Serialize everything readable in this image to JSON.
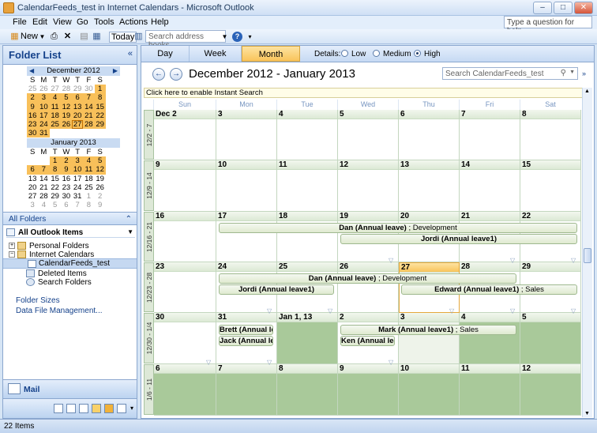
{
  "window": {
    "title": "CalendarFeeds_test in Internet Calendars - Microsoft Outlook",
    "buttons": [
      "–",
      "□",
      "✕"
    ]
  },
  "menu": {
    "items": [
      "File",
      "Edit",
      "View",
      "Go",
      "Tools",
      "Actions",
      "Help"
    ],
    "help_placeholder": "Type a question for help"
  },
  "toolbar": {
    "new_label": "New",
    "today_label": "Today",
    "address_placeholder": "Search address books"
  },
  "folder_pane": {
    "title": "Folder List",
    "collapse": "«",
    "mini_cals": [
      {
        "month": "December 2012",
        "dow": [
          "S",
          "M",
          "T",
          "W",
          "T",
          "F",
          "S"
        ],
        "weeks": [
          [
            "25",
            "26",
            "27",
            "28",
            "29",
            "30",
            "1"
          ],
          [
            "2",
            "3",
            "4",
            "5",
            "6",
            "7",
            "8"
          ],
          [
            "9",
            "10",
            "11",
            "12",
            "13",
            "14",
            "15"
          ],
          [
            "16",
            "17",
            "18",
            "19",
            "20",
            "21",
            "22"
          ],
          [
            "23",
            "24",
            "25",
            "26",
            "27",
            "28",
            "29"
          ],
          [
            "30",
            "31",
            "",
            "",
            "",
            "",
            ""
          ]
        ]
      },
      {
        "month": "January 2013",
        "dow": [
          "S",
          "M",
          "T",
          "W",
          "T",
          "F",
          "S"
        ],
        "weeks": [
          [
            "",
            "",
            "1",
            "2",
            "3",
            "4",
            "5"
          ],
          [
            "6",
            "7",
            "8",
            "9",
            "10",
            "11",
            "12"
          ],
          [
            "13",
            "14",
            "15",
            "16",
            "17",
            "18",
            "19"
          ],
          [
            "20",
            "21",
            "22",
            "23",
            "24",
            "25",
            "26"
          ],
          [
            "27",
            "28",
            "29",
            "30",
            "31",
            "1",
            "2"
          ],
          [
            "3",
            "4",
            "5",
            "6",
            "7",
            "8",
            "9"
          ]
        ]
      }
    ],
    "all_folders_label": "All Folders",
    "all_items_label": "All Outlook Items",
    "tree": {
      "personal": "Personal Folders",
      "internet": "Internet Calendars",
      "feed": "CalendarFeeds_test",
      "deleted": "Deleted Items",
      "search": "Search Folders"
    },
    "links": [
      "Folder Sizes",
      "Data File Management..."
    ],
    "mail_label": "Mail"
  },
  "calendar": {
    "view_tabs": [
      "Day",
      "Week",
      "Month"
    ],
    "active_tab": "Month",
    "details_label": "Details:",
    "details_options": [
      "Low",
      "Medium",
      "High"
    ],
    "details_selected": "High",
    "date_range": "December 2012 - January 2013",
    "search_placeholder": "Search CalendarFeeds_test",
    "instant_search": "Click here to enable Instant Search",
    "dow": [
      "Sun",
      "Mon",
      "Tue",
      "Wed",
      "Thu",
      "Fri",
      "Sat"
    ],
    "weeks": [
      {
        "label": "12/2 - 7",
        "days": [
          "Dec 2",
          "3",
          "4",
          "5",
          "6",
          "7",
          "8"
        ]
      },
      {
        "label": "12/9 - 14",
        "days": [
          "9",
          "10",
          "11",
          "12",
          "13",
          "14",
          "15"
        ]
      },
      {
        "label": "12/16 - 21",
        "days": [
          "16",
          "17",
          "18",
          "19",
          "20",
          "21",
          "22"
        ]
      },
      {
        "label": "12/23 - 28",
        "days": [
          "23",
          "24",
          "25",
          "26",
          "27",
          "28",
          "29"
        ]
      },
      {
        "label": "12/30 - 1/4",
        "days": [
          "30",
          "31",
          "Jan 1, 13",
          "2",
          "3",
          "4",
          "5"
        ]
      },
      {
        "label": "1/6 - 11",
        "days": [
          "6",
          "7",
          "8",
          "9",
          "10",
          "11",
          "12"
        ]
      }
    ],
    "events": {
      "dan1_name": "Dan (Annual leave)",
      "dan1_dept": " ; Development",
      "jordi1": "Jordi (Annual leave1)",
      "dan2_name": "Dan (Annual leave)",
      "dan2_dept": " ; Development",
      "jordi2": "Jordi (Annual leave1)",
      "edward_name": "Edward (Annual leave1)",
      "edward_dept": " ; Sales",
      "brett": "Brett (Annual le",
      "jack": "Jack (Annual lea",
      "mark_name": "Mark (Annual leave1)",
      "mark_dept": " ; Sales",
      "ken": "Ken (Annual lea"
    }
  },
  "status": {
    "items": "22 Items"
  }
}
